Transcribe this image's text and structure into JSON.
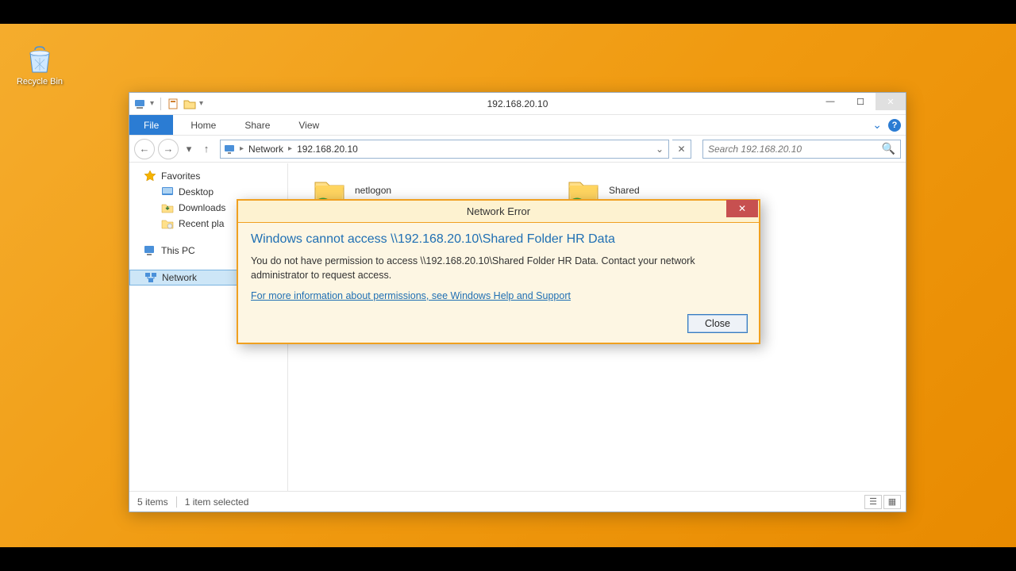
{
  "desktop": {
    "recycle_bin_label": "Recycle Bin"
  },
  "explorer": {
    "title": "192.168.20.10",
    "ribbon": {
      "file": "File",
      "home": "Home",
      "share": "Share",
      "view": "View",
      "min_ribbon": "⌄"
    },
    "address": {
      "seg1": "Network",
      "seg2": "192.168.20.10"
    },
    "search": {
      "placeholder": "Search 192.168.20.10"
    },
    "tree": {
      "favorites": "Favorites",
      "desktop": "Desktop",
      "downloads": "Downloads",
      "recent": "Recent pla",
      "this_pc": "This PC",
      "network": "Network"
    },
    "folders": {
      "netlogon": "netlogon",
      "shared": "Shared"
    },
    "status": {
      "items": "5 items",
      "selected": "1 item selected"
    }
  },
  "dialog": {
    "title": "Network Error",
    "heading": "Windows cannot access \\\\192.168.20.10\\Shared Folder HR Data",
    "message": "You do not have permission to access \\\\192.168.20.10\\Shared Folder HR Data. Contact your network administrator to request access.",
    "link": "For more information about permissions, see Windows Help and Support",
    "close_btn": "Close"
  }
}
